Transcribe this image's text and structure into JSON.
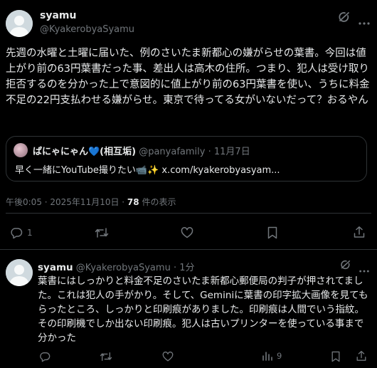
{
  "main_tweet": {
    "name": "syamu",
    "handle": "@KyakerobyaSyamu",
    "text": "先週の水曜と土曜に届いた、例のさいたま新都心の嫌がらせの葉書。今回は値上がり前の63円葉書だった事、差出人は高木の住所。つまり、犯人は受け取り拒否するのを分かった上で意図的に値上がり前の63円葉書を使い、うちに料金不足の22円支払わせる嫌がらせ。東京で待ってる女がいないだって？おるやん",
    "quote": {
      "name": "ぱにゃにゃん💙(相互垢)",
      "handle": "@panyafamily",
      "sep": "·",
      "date": "11月7日",
      "text": "早く一緒にYouTube撮りたい📹✨ x.com/kyakerobyasyam..."
    },
    "timestamp": "午後0:05 · 2025年11月10日 · ",
    "views_count": "78",
    "views_label": " 件の表示",
    "actions": {
      "reply_count": "1"
    }
  },
  "reply_tweet": {
    "name": "syamu",
    "handle": "@KyakerobyaSyamu · 1分",
    "text": "葉書にはしっかりと料金不足のさいたま新都心郵便局の判子が押されてました。これは犯人の手がかり。そして、Geminiに葉書の印字拡大画像を見てもらったところ、しっかりと印刷痕がありました。印刷痕は人間でいう指紋。その印刷機でしか出ない印刷痕。犯人は古いプリンターを使っている事まで分かった",
    "views_count": "9"
  },
  "colors": {
    "background": "#000000",
    "text": "#e7e9ea",
    "secondary": "#71767b",
    "border": "#2f3336"
  },
  "icons": [
    "grok-icon",
    "more-icon",
    "reply-icon",
    "retweet-icon",
    "like-icon",
    "bookmark-icon",
    "share-icon",
    "views-icon",
    "avatar-placeholder"
  ]
}
